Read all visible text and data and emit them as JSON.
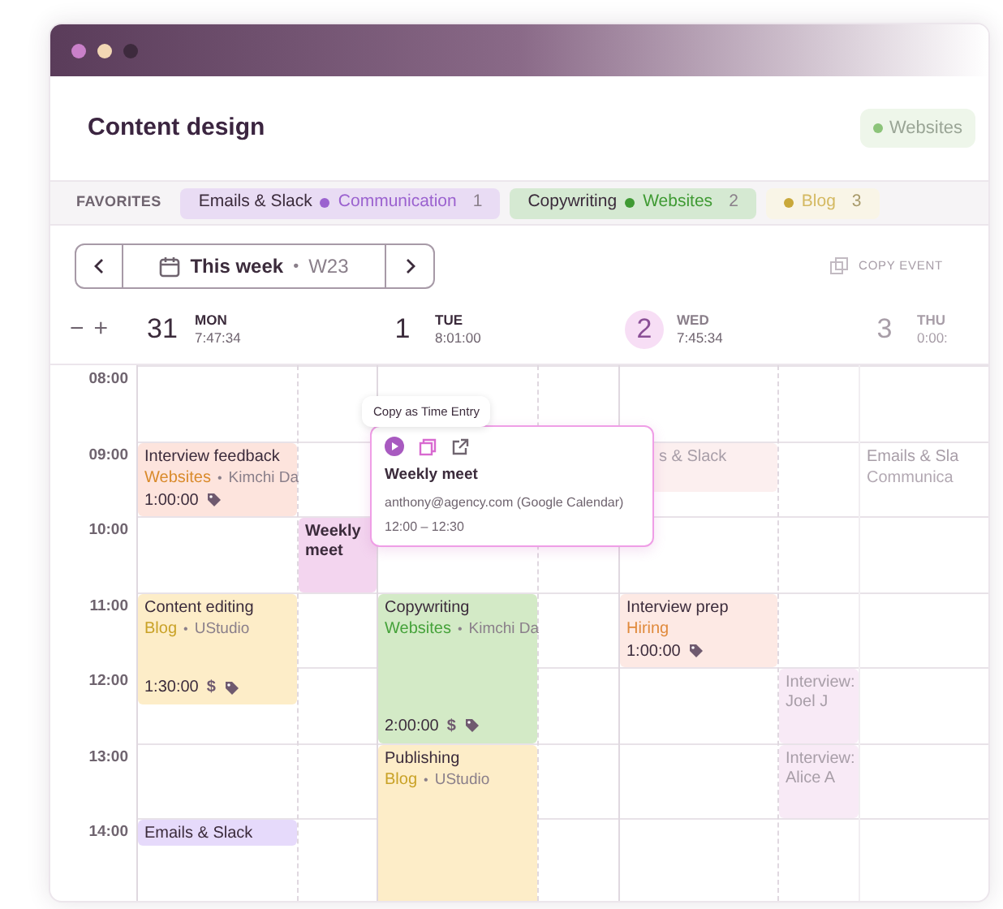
{
  "window": {
    "title": "Content design"
  },
  "header_chip": {
    "label": "Websites",
    "color": "#8cc47a"
  },
  "favorites": {
    "label": "FAVORITES",
    "items": [
      {
        "title": "Emails & Slack",
        "project": "Communication",
        "count": "1",
        "color": "#9b62cf",
        "faded": false
      },
      {
        "title": "Copywriting",
        "project": "Websites",
        "count": "2",
        "color": "#3f9a33",
        "faded": false
      },
      {
        "project": "Blog",
        "count": "3",
        "color": "#c9a83a",
        "faded": true
      }
    ]
  },
  "nav": {
    "label": "This week",
    "separator": "•",
    "week": "W23",
    "copy_label": "COPY EVENT"
  },
  "zoom_controls": [
    "−",
    "+"
  ],
  "days": [
    {
      "date": "31",
      "weekday": "MON",
      "time": "7:47:34",
      "today": false,
      "faded": false
    },
    {
      "date": "1",
      "weekday": "TUE",
      "time": "8:01:00",
      "today": false,
      "faded": false
    },
    {
      "date": "2",
      "weekday": "WED",
      "time": "7:45:34",
      "today": true,
      "faded": false
    },
    {
      "date": "3",
      "weekday": "THU",
      "time": "0:00:",
      "today": false,
      "faded": true
    }
  ],
  "hours": [
    "08:00",
    "09:00",
    "10:00",
    "11:00",
    "12:00",
    "13:00",
    "14:00"
  ],
  "events": [
    {
      "title": "Interview feedback",
      "category": {
        "label": "Websites",
        "color": "#d98a2b"
      },
      "separator": "•",
      "client": "Kimchi Da",
      "duration": "1:00:00",
      "tagged": true,
      "color": "#fde4dd",
      "faded": false
    },
    {
      "title": "s & Slack",
      "color": "#fcefef",
      "faded": true
    },
    {
      "title": "Emails & Sla",
      "category": {
        "label": "Communica",
        "color": "#b3a9b3"
      },
      "color": "#ffffff",
      "faded": true
    },
    {
      "title": "Weekly meet",
      "color": "#f3d5ef",
      "faded": false
    },
    {
      "title": "Content editing",
      "category": {
        "label": "Blog",
        "color": "#c9a227"
      },
      "separator": "•",
      "client": "UStudio",
      "duration": "1:30:00",
      "billable_icon": "$",
      "tagged": true,
      "color": "#fdedc8",
      "faded": false
    },
    {
      "title": "Copywriting",
      "category": {
        "label": "Websites",
        "color": "#45a23a"
      },
      "separator": "•",
      "client": "Kimchi Da",
      "duration": "2:00:00",
      "billable_icon": "$",
      "tagged": true,
      "color": "#d3eac6",
      "faded": false
    },
    {
      "title": "Interview prep",
      "category": {
        "label": "Hiring",
        "color": "#e08a3c"
      },
      "duration": "1:00:00",
      "tagged": true,
      "color": "#fde9e4",
      "faded": false
    },
    {
      "title": "Interview: Joel J",
      "color": "#f8eaf6",
      "faded": true
    },
    {
      "title": "Publishing",
      "category": {
        "label": "Blog",
        "color": "#c9a227"
      },
      "separator": "•",
      "client": "UStudio",
      "color": "#fdedc8",
      "faded": false
    },
    {
      "title": "Interview: Alice A",
      "color": "#f8eaf6",
      "faded": true
    },
    {
      "title": "Emails & Slack",
      "color": "#e6dafb",
      "faded": false
    }
  ],
  "tooltip": "Copy as Time Entry",
  "popup": {
    "title": "Weekly meet",
    "source": "anthony@agency.com (Google Calendar)",
    "time": "12:00 – 12:30"
  }
}
